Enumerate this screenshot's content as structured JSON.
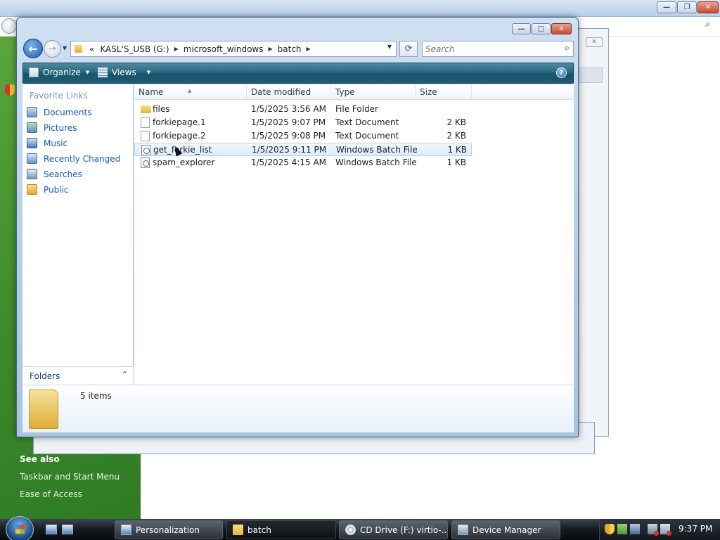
{
  "background": {
    "see_also": "See also",
    "links": [
      "Taskbar and Start Menu",
      "Ease of Access"
    ]
  },
  "window": {
    "title": "batch",
    "address": {
      "overflow": "«",
      "crumbs": [
        "KASL'S_USB (G:)",
        "microsoft_windows",
        "batch"
      ]
    },
    "search": {
      "placeholder": "Search"
    },
    "toolbar": {
      "organize": "Organize",
      "views": "Views",
      "help": "?"
    }
  },
  "navpane": {
    "header": "Favorite Links",
    "links": [
      "Documents",
      "Pictures",
      "Music",
      "Recently Changed",
      "Searches",
      "Public"
    ],
    "folders_label": "Folders"
  },
  "filelist": {
    "columns": [
      "Name",
      "Date modified",
      "Type",
      "Size"
    ],
    "rows": [
      {
        "name": "files",
        "date": "1/5/2025 3:56 AM",
        "type": "File Folder",
        "size": "",
        "icon": "folder-icon"
      },
      {
        "name": "forkiepage.1",
        "date": "1/5/2025 9:07 PM",
        "type": "Text Document",
        "size": "2 KB",
        "icon": "text-file-icon"
      },
      {
        "name": "forkiepage.2",
        "date": "1/5/2025 9:08 PM",
        "type": "Text Document",
        "size": "2 KB",
        "icon": "text-file-icon"
      },
      {
        "name": "get_forkie_list",
        "date": "1/5/2025 9:11 PM",
        "type": "Windows Batch File",
        "size": "1 KB",
        "icon": "batch-file-icon",
        "selected": true
      },
      {
        "name": "spam_explorer",
        "date": "1/5/2025 4:15 AM",
        "type": "Windows Batch File",
        "size": "1 KB",
        "icon": "batch-file-icon"
      }
    ]
  },
  "details": {
    "item_count": "5 items"
  },
  "taskbar": {
    "buttons": [
      "Personalization",
      "batch",
      "CD Drive (F:) virtio-...",
      "Device Manager"
    ],
    "active": "batch",
    "clock": "9:37 PM"
  },
  "colors": {
    "toolbar": "#2a6880",
    "link": "#1856b3",
    "selection": "#dcecfb",
    "desktop_green": "#3d8b2c"
  }
}
